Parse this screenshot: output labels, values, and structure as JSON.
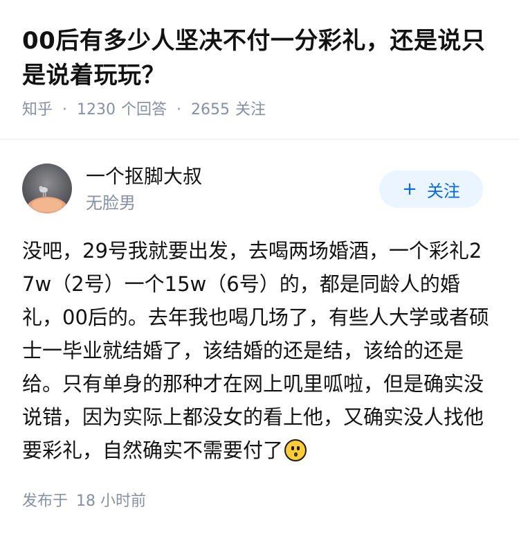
{
  "question": {
    "title": "00后有多少人坚决不付一分彩礼，还是说只是说着玩玩？",
    "source": "知乎",
    "separator": "·",
    "answers_count": "1230",
    "answers_label": "个回答",
    "follows_count": "2655",
    "follows_label": "关注"
  },
  "author": {
    "name": "一个抠脚大叔",
    "bio": "无脸男",
    "avatar_icon": "avatar-photo"
  },
  "follow_button": {
    "plus": "+",
    "label": "关注"
  },
  "answer": {
    "text": "没吧，29号我就要出发，去喝两场婚酒，一个彩礼27w（2号）一个15w（6号）的，都是同龄人的婚礼，00后的。去年我也喝几场了，有些人大学或者硕士一毕业就结婚了，该结婚的还是结，该给的还是给。只有单身的那种才在网上叽里呱啦，但是确实没说错，因为实际上都没女的看上他，又确实没人找他要彩礼，自然确实不需要付了",
    "trailing_emoji": "hushed-face-icon"
  },
  "footer": {
    "published_label": "发布于",
    "published_time": "18 小时前"
  },
  "colors": {
    "muted": "#8590a6",
    "accent": "#0066ff",
    "button_bg": "#ebf5ff"
  }
}
